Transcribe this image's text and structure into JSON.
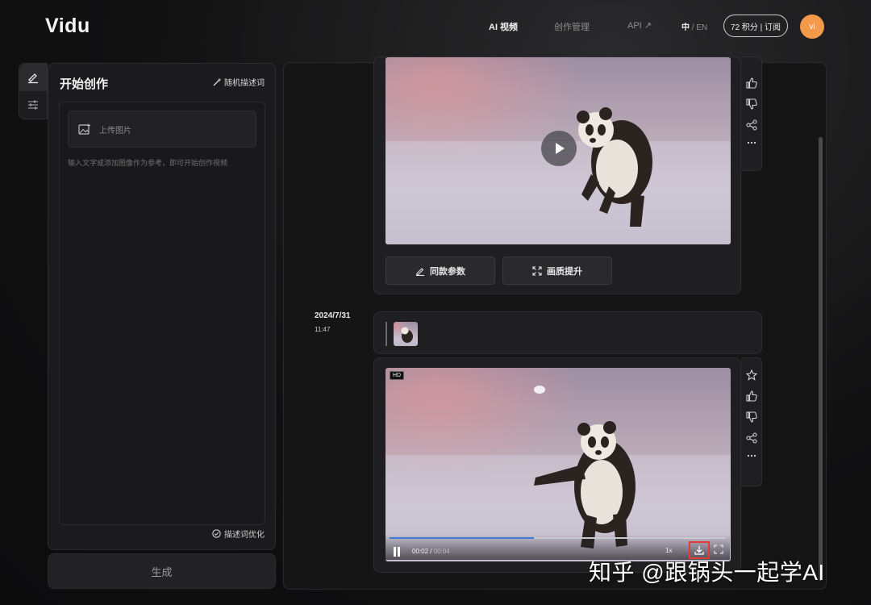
{
  "app": {
    "logo": "Vidu"
  },
  "nav": {
    "items": [
      {
        "label": "AI 视频",
        "active": true
      },
      {
        "label": "创作管理",
        "active": false
      },
      {
        "label": "API ↗",
        "active": false
      }
    ],
    "lang_current": "中",
    "lang_sep": " / ",
    "lang_other": "EN",
    "credits_label": "72 积分 | 订阅",
    "avatar_initials": "vi"
  },
  "rail": {
    "tools": [
      "brush-icon",
      "sliders-icon"
    ]
  },
  "create": {
    "title": "开始创作",
    "random_label": "随机描述词",
    "upload_label": "上传图片",
    "prompt_placeholder": "输入文字或添加图像作为参考，即可开始创作视频",
    "optimize_label": "描述词优化",
    "generate_label": "生成"
  },
  "results": {
    "first_card": {
      "same_params_label": "同款参数",
      "upscale_label": "画质提升"
    },
    "second_card": {
      "date": "2024/7/31",
      "time": "11:47",
      "hd_badge": "HD",
      "player": {
        "current_time": "00:02",
        "separator": " / ",
        "duration": "00:04",
        "speed": "1x",
        "progress": 0.43
      }
    }
  },
  "watermark": "知乎 @跟锅头一起学AI",
  "colors": {
    "accent": "#3c7ad6",
    "avatar": "#f2994a",
    "highlight": "#e53935"
  }
}
